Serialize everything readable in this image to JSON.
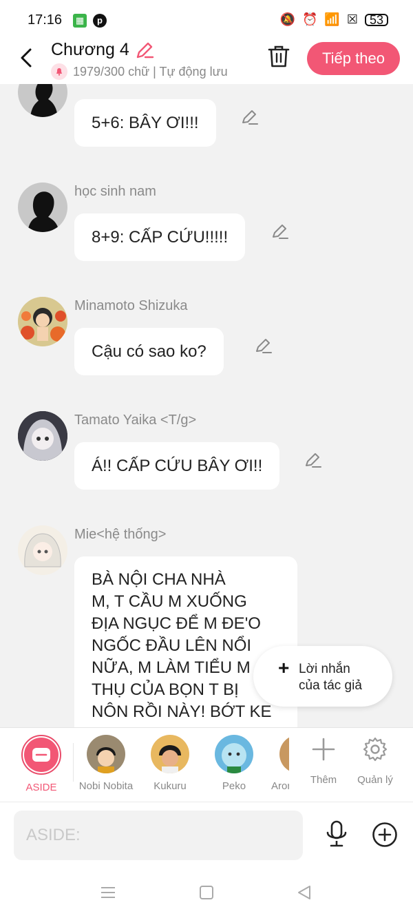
{
  "status_bar": {
    "time": "17:16",
    "battery": "53"
  },
  "header": {
    "title": "Chương 4",
    "subtitle": "1979/300 chữ | Tự động lưu",
    "next_label": "Tiếp theo"
  },
  "messages": [
    {
      "name": "",
      "text": "5+6: BÂY ƠI!!!"
    },
    {
      "name": "học sinh nam",
      "text": "8+9: CẤP CỨU!!!!!"
    },
    {
      "name": "Minamoto Shizuka",
      "text": "Cậu có sao ko?"
    },
    {
      "name": "Tamato Yaika <T/g>",
      "text": "Á!! CẤP CỨU BÂY ƠI!!"
    },
    {
      "name": "Mie<hệ thống>",
      "lines": [
        "BÀ NỘI CHA NHÀ",
        "M, T CẦU M XUỐNG",
        "ĐỊA NGỤC ĐỂ M ĐE'O",
        "NGỐC ĐẦU LÊN NỔI",
        "NỮA, M LÀM TIỂU M",
        "THỤ CỦA BỌN T BỊ",
        "NÔN RỒI NÀY! BỚT KE"
      ]
    }
  ],
  "author_note": {
    "line1": "Lời nhắn",
    "line2": "của tác giả"
  },
  "characters": [
    "ASIDE",
    "Nobi Nobita",
    "Kukuru",
    "Peko",
    "Aron"
  ],
  "tools": {
    "add": "Thêm",
    "manage": "Quản lý"
  },
  "input": {
    "placeholder": "ASIDE:"
  }
}
